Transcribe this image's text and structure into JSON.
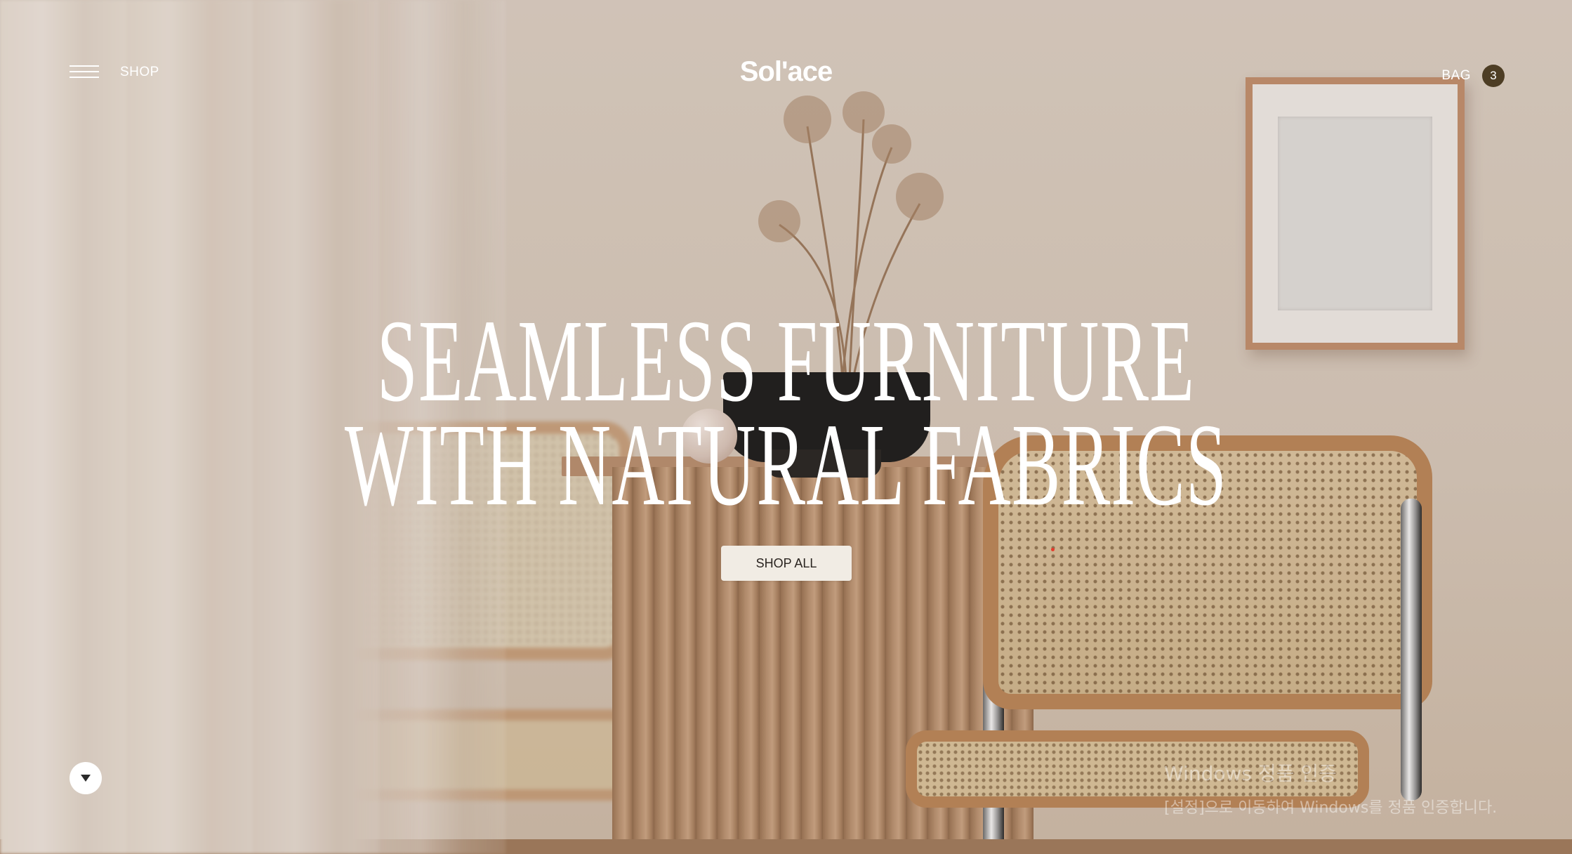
{
  "header": {
    "menu_icon": "hamburger-icon",
    "shop_label": "SHOP",
    "logo_text": "Sol'ace",
    "bag_label": "BAG",
    "bag_count": "3"
  },
  "hero": {
    "line1": "SEAMLESS FURNITURE",
    "line2": "WITH NATURAL FABRICS",
    "cta_label": "SHOP ALL"
  },
  "scroll_button": {
    "icon": "triangle-down-icon"
  },
  "os_watermark": {
    "title": "Windows 정품 인증",
    "subtitle": "[설정]으로 이동하여 Windows를 정품 인증합니다."
  },
  "colors": {
    "bag_badge": "#4d3d24",
    "cta_background": "#f1ece4",
    "hero_text": "#ffffff"
  }
}
